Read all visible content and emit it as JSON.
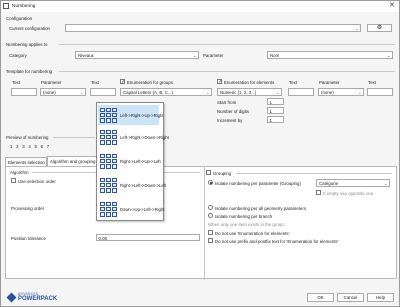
{
  "window": {
    "title": "Numbering"
  },
  "configuration": {
    "section_label": "Configuration",
    "current_label": "Current configuration",
    "current_value": ""
  },
  "applies": {
    "section_label": "Numbering applies to",
    "category_label": "Category",
    "category_value": "Niveaux",
    "parameter_label": "Parameter",
    "parameter_value": "Nom"
  },
  "template": {
    "section_label": "Template for numbering",
    "left": {
      "text1_label": "Text",
      "param_label": "Parameter",
      "param_value": "(none)",
      "text2_label": "Text",
      "enum_label": "Enumeration for groups",
      "enum_checked": true,
      "enum_value": "Capital Letters (A, B, C...)"
    },
    "right": {
      "enum_label": "Enumeration for elements",
      "enum_checked": true,
      "enum_value": "Numeric (1, 2, 3...)",
      "text1_label": "Text",
      "param_label": "Parameter",
      "param_value": "(none)",
      "text2_label": "Text"
    },
    "start_from_label": "Start from",
    "start_from_value": "1",
    "digits_label": "Number of digits",
    "digits_value": "1",
    "increment_label": "Increment by",
    "increment_value": "1"
  },
  "preview": {
    "section_label": "Preview of numbering",
    "values": [
      "1",
      "2",
      "3",
      "4",
      "5",
      "6",
      "7"
    ]
  },
  "tabs": [
    {
      "label": "Elements selection"
    },
    {
      "label": "Algorithm and grouping"
    }
  ],
  "algorithm": {
    "section_label": "Algorithm",
    "selection_order_label": "Use selection order",
    "processing_label": "Processing order",
    "tolerance_label": "Position tolerance",
    "tolerance_value": "0.00"
  },
  "order_options": [
    {
      "label": "Left->Right->Up->Right"
    },
    {
      "label": "Left->Right->Down->Right"
    },
    {
      "label": "Right->Left->Up->Left"
    },
    {
      "label": "Right->Left->Down->Left"
    },
    {
      "label": "Down->Up->Left->Right"
    }
  ],
  "grouping": {
    "checkbox_label": "Grouping",
    "isolate_param_label": "Isolate numbering per parameter (Grouping)",
    "category_value": "Catégorie",
    "if_empty_label": "If empty use opposite one",
    "isolate_all_label": "Isolate numbering per all geometry parameters",
    "isolate_branch_label": "Isolate numbering per branch",
    "only_one_label": "When only one item exists in the group:",
    "no_enum_label": "Do not use 'Enumeration for elements'",
    "no_prefix_label": "Do not use prefix and postfix text for 'Enumeration for elements'"
  },
  "brand": {
    "line1": "ADVANCED",
    "line2": "POWERPACK",
    "color": "#27539b"
  },
  "footer": {
    "ok": "OK",
    "cancel": "Cancel",
    "help": "Help"
  }
}
